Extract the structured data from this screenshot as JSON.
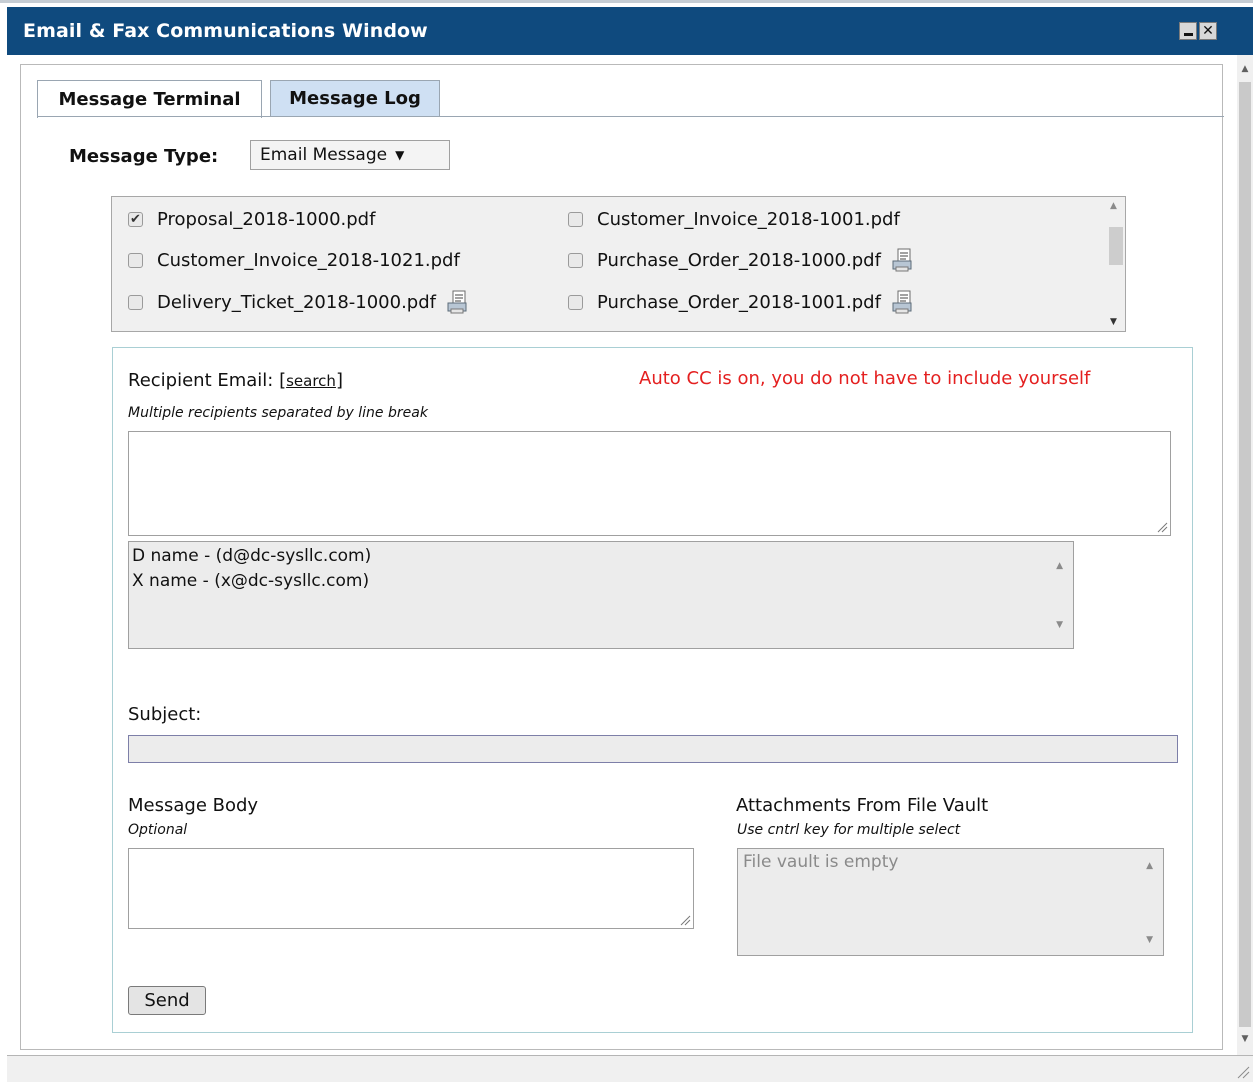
{
  "window": {
    "title": "Email & Fax Communications Window",
    "titlebar_color": "#0f4a7e",
    "min_icon": "minimize-icon",
    "close_icon": "close-icon"
  },
  "tabs": [
    {
      "label": "Message Terminal",
      "active": true
    },
    {
      "label": "Message Log",
      "active": false
    }
  ],
  "message_type": {
    "label": "Message Type:",
    "selected": "Email Message",
    "arrow": "▼"
  },
  "files": [
    {
      "name": "Proposal_2018-1000.pdf",
      "checked": true,
      "has_icon": false
    },
    {
      "name": "Customer_Invoice_2018-1001.pdf",
      "checked": false,
      "has_icon": false
    },
    {
      "name": "Customer_Invoice_2018-1021.pdf",
      "checked": false,
      "has_icon": false
    },
    {
      "name": "Purchase_Order_2018-1000.pdf",
      "checked": false,
      "has_icon": true
    },
    {
      "name": "Delivery_Ticket_2018-1000.pdf",
      "checked": false,
      "has_icon": true
    },
    {
      "name": "Purchase_Order_2018-1001.pdf",
      "checked": false,
      "has_icon": true
    }
  ],
  "recipient": {
    "label": "Recipient Email: [",
    "search_link": "search",
    "label_end": "]",
    "auto_cc": "Auto CC is on, you do not have to include yourself",
    "auto_cc_color": "#e42020",
    "hint": "Multiple recipients separated by line break",
    "value": "",
    "contacts": [
      "D name - (d@dc-sysllc.com)",
      "X name - (x@dc-sysllc.com)"
    ]
  },
  "subject": {
    "label": "Subject:",
    "value": ""
  },
  "body": {
    "label": "Message Body",
    "hint": "Optional",
    "value": ""
  },
  "attachments": {
    "label": "Attachments From File Vault",
    "hint": "Use cntrl key for multiple select",
    "empty_text": "File vault is empty"
  },
  "send_label": "Send"
}
